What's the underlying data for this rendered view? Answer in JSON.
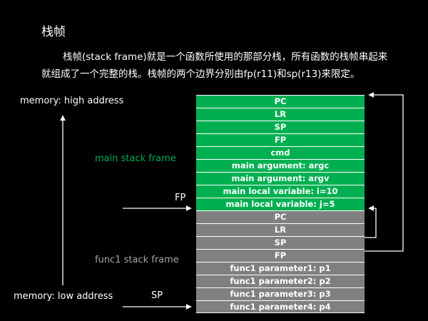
{
  "title": "栈帧",
  "paragraph": {
    "line1": "栈帧(stack frame)就是一个函数所使用的那部分栈，所有函数的栈帧串起来",
    "line2": "就组成了一个完整的栈。栈帧的两个边界分别由fp(r11)和sp(r13)来限定。"
  },
  "labels": {
    "high_address": "memory: high address",
    "low_address": "memory: low address",
    "main_frame": "main stack frame",
    "func1_frame": "func1 stack frame",
    "fp": "FP",
    "sp": "SP"
  },
  "colors": {
    "main_frame": "#00b050",
    "func1_frame": "#808080",
    "main_label": "#00b050",
    "func1_label": "#a6a6a6"
  },
  "stack_cells": [
    {
      "text": "PC",
      "frame": "main"
    },
    {
      "text": "LR",
      "frame": "main"
    },
    {
      "text": "SP",
      "frame": "main"
    },
    {
      "text": "FP",
      "frame": "main"
    },
    {
      "text": "cmd",
      "frame": "main"
    },
    {
      "text": "main argument: argc",
      "frame": "main"
    },
    {
      "text": "main argument: argv",
      "frame": "main"
    },
    {
      "text": "main local variable: i=10",
      "frame": "main"
    },
    {
      "text": "main local variable: j=5",
      "frame": "main"
    },
    {
      "text": "PC",
      "frame": "func"
    },
    {
      "text": "LR",
      "frame": "func"
    },
    {
      "text": "SP",
      "frame": "func"
    },
    {
      "text": "FP",
      "frame": "func"
    },
    {
      "text": "func1 parameter1: p1",
      "frame": "func"
    },
    {
      "text": "func1 parameter2: p2",
      "frame": "func"
    },
    {
      "text": "func1 parameter3: p3",
      "frame": "func"
    },
    {
      "text": "func1 parameter4: p4",
      "frame": "func"
    }
  ]
}
